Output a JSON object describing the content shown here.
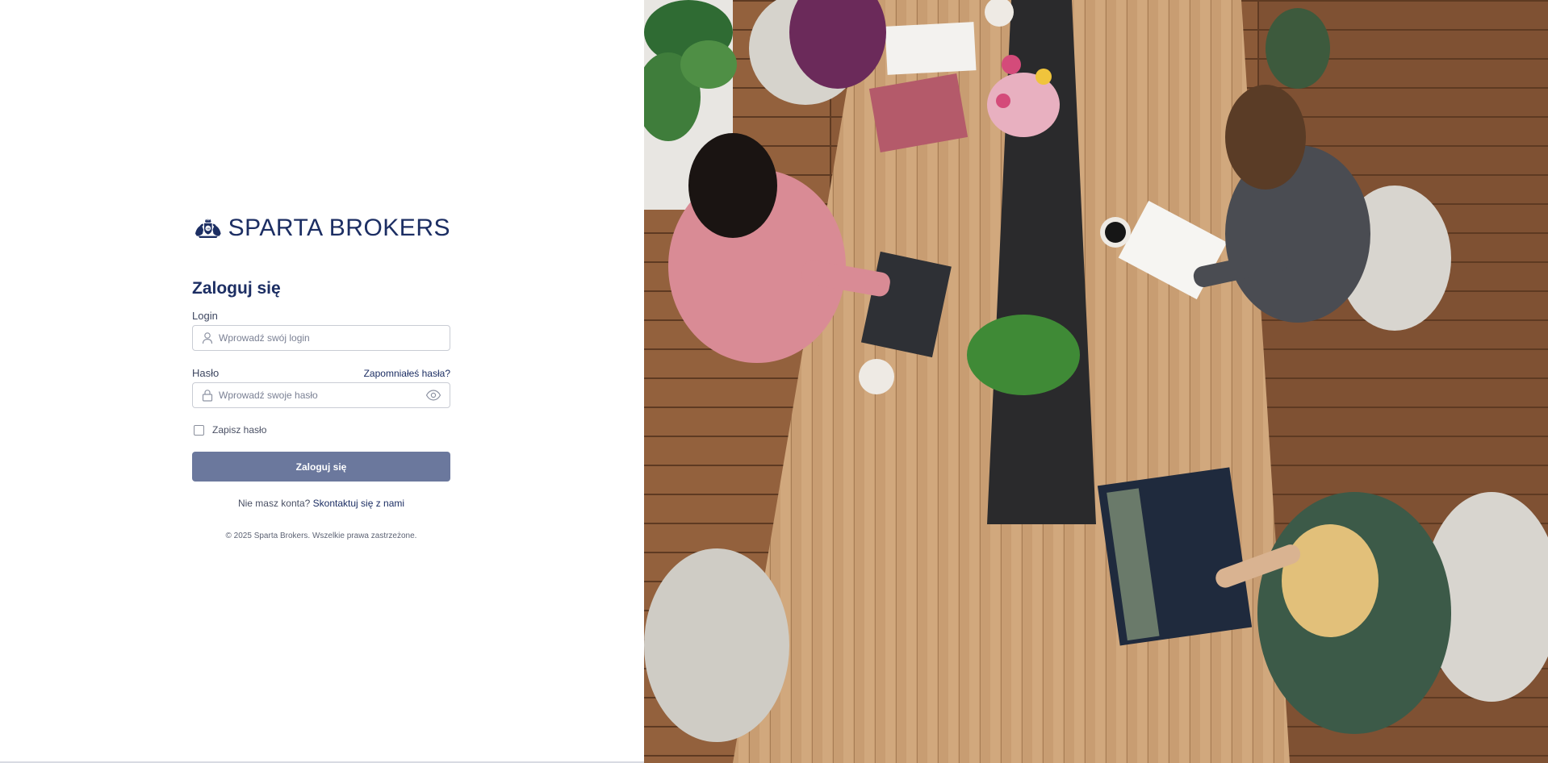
{
  "brand": {
    "name": "SPARTA BROKERS",
    "logo_icon": "sparta-crest-icon",
    "color": "#1c2e63"
  },
  "login_form": {
    "title": "Zaloguj się",
    "login_label": "Login",
    "login_placeholder": "Wprowadź swój login",
    "login_value": "",
    "password_label": "Hasło",
    "forgot_password_link": "Zapomniałeś hasła?",
    "password_placeholder": "Wprowadź swoje hasło",
    "password_value": "",
    "remember_label": "Zapisz hasło",
    "remember_checked": false,
    "submit_label": "Zaloguj się",
    "submit_color": "#6b789d",
    "no_account_text": "Nie masz konta?",
    "contact_link": "Skontaktuj się z nami",
    "copyright": "© 2025 Sparta Brokers. Wszelkie prawa zastrzeżone."
  },
  "icons": {
    "login_field": "user-icon",
    "password_field": "lock-icon",
    "password_toggle": "eye-icon"
  },
  "hero_image": {
    "subject": "office-team-photo",
    "dominant_colors": [
      "#8a5a3a",
      "#c9a27a",
      "#e3e0da"
    ]
  }
}
